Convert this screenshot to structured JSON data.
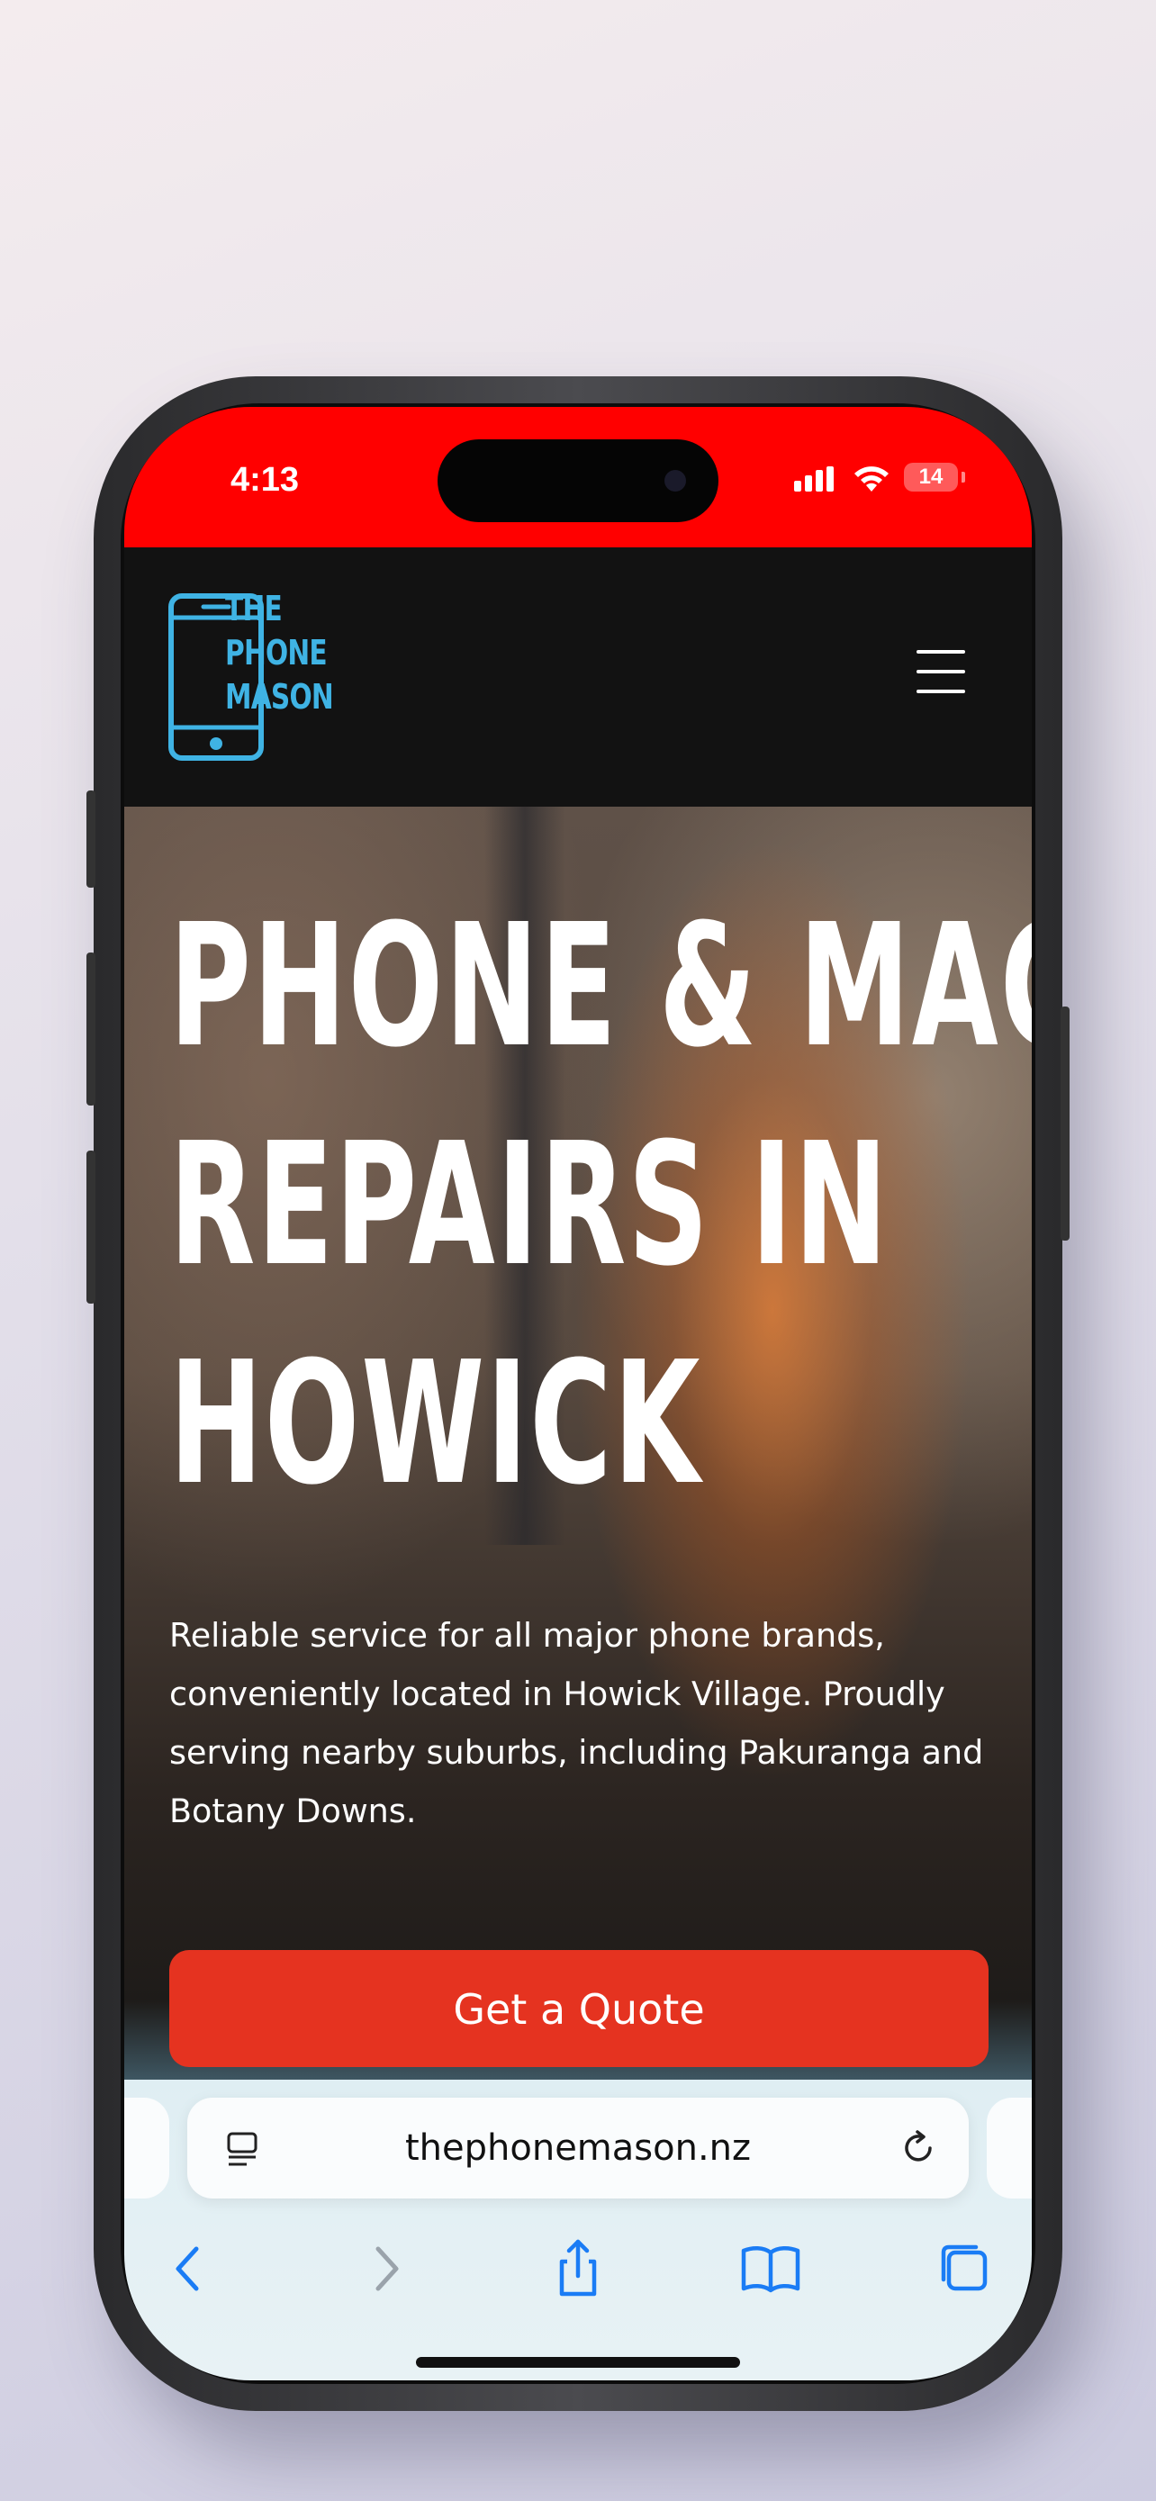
{
  "status_bar": {
    "time": "4:13",
    "battery": "14",
    "background_color": "#ff0000"
  },
  "site_header": {
    "logo_lines": [
      "THE",
      "PHONE",
      "MASON"
    ],
    "logo_color": "#3fb3e4",
    "logo_icon": "smartphone-icon",
    "menu_icon": "hamburger-menu-icon"
  },
  "hero": {
    "title_lines": [
      "PHONE & MAC",
      "REPAIRS IN",
      "HOWICK"
    ],
    "description": "Reliable service for all major phone brands, conveniently located in Howick Village. Proudly serving nearby suburbs, including Pakuranga and Botany Downs.",
    "cta_label": "Get a Quote",
    "cta_color": "#e53320"
  },
  "browser": {
    "url": "thephonemason.nz",
    "page_menu_icon": "page-menu-icon",
    "reload_icon": "reload-icon",
    "toolbar_icons": [
      "back-icon",
      "forward-icon",
      "share-icon",
      "bookmarks-icon",
      "tabs-icon"
    ],
    "accent_color": "#1a7cf5"
  }
}
